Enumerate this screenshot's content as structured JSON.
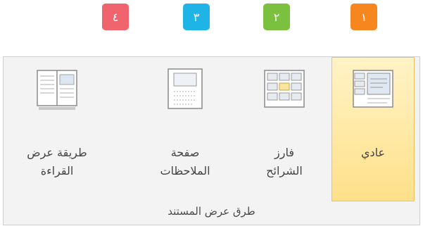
{
  "badges": [
    {
      "label": "٤",
      "color": "#f0646e"
    },
    {
      "label": "٣",
      "color": "#1eb4e6"
    },
    {
      "label": "٢",
      "color": "#7cc040"
    },
    {
      "label": "١",
      "color": "#f5871e"
    }
  ],
  "ribbon": {
    "group_label": "طرق عرض المستند",
    "buttons": [
      {
        "line1": "طريقة عرض",
        "line2": "القراءة"
      },
      {
        "line1": "صفحة",
        "line2": "الملاحظات"
      },
      {
        "line1": "فارز",
        "line2": "الشرائح"
      },
      {
        "line1": "عادي",
        "line2": ""
      }
    ]
  },
  "colors": {
    "selected_fill": "#ffe08a",
    "ribbon_bg": "#f3f3f3"
  }
}
